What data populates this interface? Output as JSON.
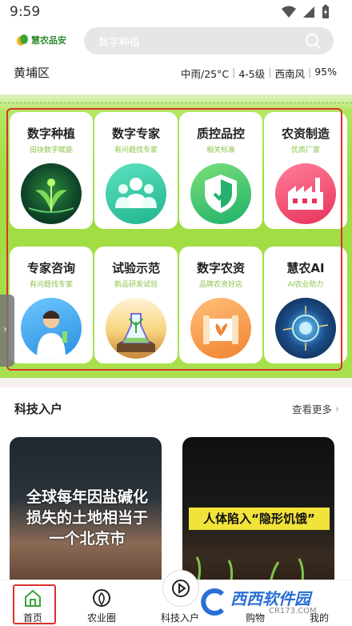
{
  "status_bar": {
    "time": "9:59"
  },
  "header": {
    "logo_text": "慧农品安",
    "search_placeholder": "数字种植"
  },
  "weather": {
    "district": "黄埔区",
    "condition": "中雨/25°C",
    "wind_level": "4-5级",
    "wind_dir": "西南风",
    "humidity": "95%"
  },
  "grid": {
    "tiles": [
      {
        "title": "数字种植",
        "subtitle": "田块数字赋能",
        "icon": "plant-icon"
      },
      {
        "title": "数字专家",
        "subtitle": "有问题找专家",
        "icon": "expert-group-icon"
      },
      {
        "title": "质控品控",
        "subtitle": "相关标准",
        "icon": "shield-check-icon"
      },
      {
        "title": "农资制造",
        "subtitle": "优质厂家",
        "icon": "factory-icon"
      },
      {
        "title": "专家咨询",
        "subtitle": "有问题找专家",
        "icon": "scientist-icon"
      },
      {
        "title": "试验示范",
        "subtitle": "新品研发试验",
        "icon": "lab-flask-icon"
      },
      {
        "title": "数字农资",
        "subtitle": "品牌农资好店",
        "icon": "seed-bag-icon"
      },
      {
        "title": "慧农AI",
        "subtitle": "AI农业助力",
        "icon": "ai-brain-icon"
      }
    ]
  },
  "section": {
    "title": "科技入户",
    "more": "查看更多"
  },
  "cards": [
    {
      "text": "全球每年因盐碱化损失的土地相当于一个北京市"
    },
    {
      "caption": "人体陷入“隐形饥饿”"
    }
  ],
  "bottom_nav": {
    "items": [
      {
        "label": "首页",
        "icon": "home-icon"
      },
      {
        "label": "农业圈",
        "icon": "leaf-circle-icon"
      },
      {
        "label": "科技入户",
        "icon": "play-icon"
      },
      {
        "label": "购物",
        "icon": "cart-icon"
      },
      {
        "label": "我的",
        "icon": "user-icon"
      }
    ]
  },
  "watermark": {
    "text": "西西软件园",
    "url": "CR173.COM"
  },
  "colors": {
    "accent_green": "#8bc34a",
    "highlight_red": "#d9322b"
  }
}
